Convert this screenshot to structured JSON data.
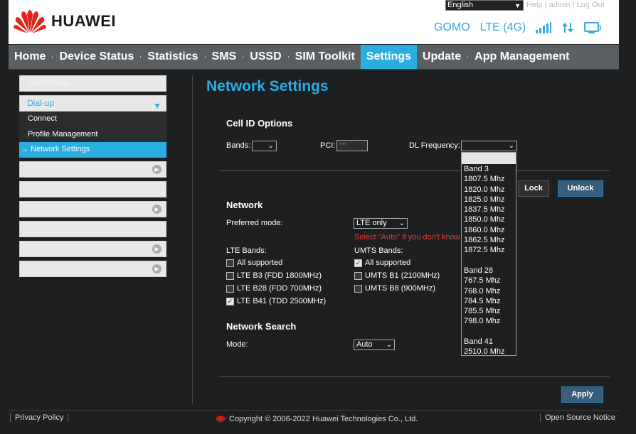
{
  "header": {
    "brand": "HUAWEI",
    "language": "English",
    "top_links": "Help | admin | Log Out",
    "operator": "GOMO",
    "network_type": "LTE (4G)"
  },
  "nav": {
    "items": [
      "Home",
      "Device Status",
      "Statistics",
      "SMS",
      "USSD",
      "SIM Toolkit",
      "Settings",
      "Update",
      "App Management"
    ],
    "active": "Settings"
  },
  "sidebar": {
    "top_item": "Quick Setup",
    "open_item": "Dial-up",
    "sub_items": [
      "Connect",
      "Profile Management",
      "Network Settings"
    ],
    "active_sub": "→ Network Settings",
    "other_items": [
      "Ethernet",
      "WLAN",
      "Security",
      "System",
      "Advanced",
      "Update"
    ]
  },
  "main": {
    "title": "Network Settings",
    "cell_id": {
      "heading": "Cell ID Options",
      "bands_label": "Bands:",
      "pci_label": "PCI:",
      "pci_placeholder": "***",
      "dl_freq_label": "DL Frequency:",
      "lock_label": "Lock",
      "unlock_label": "Unlock"
    },
    "network": {
      "heading": "Network",
      "preferred_mode_label": "Preferred mode:",
      "preferred_mode_value": "LTE only",
      "warning": "Select \"Auto\" if you don't know",
      "lte_bands_label": "LTE Bands:",
      "umts_bands_label": "UMTS Bands:",
      "lte_bands": [
        {
          "label": "All supported",
          "checked": false
        },
        {
          "label": "LTE B3 (FDD 1800MHz)",
          "checked": false
        },
        {
          "label": "LTE B28 (FDD 700MHz)",
          "checked": false
        },
        {
          "label": "LTE B41 (TDD 2500MHz)",
          "checked": true
        }
      ],
      "umts_bands": [
        {
          "label": "All supported",
          "checked": true
        },
        {
          "label": "UMTS B1 (2100MHz)",
          "checked": false
        },
        {
          "label": "UMTS B8 (900MHz)",
          "checked": false
        }
      ]
    },
    "search": {
      "heading": "Network Search",
      "mode_label": "Mode:",
      "mode_value": "Auto"
    },
    "apply_label": "Apply"
  },
  "freq_list": [
    "Band 3",
    "1807.5 Mhz",
    "1820.0 Mhz",
    "1825.0 Mhz",
    "1837.5 Mhz",
    "1850.0 Mhz",
    "1860.0 Mhz",
    "1862.5 Mhz",
    "1872.5 Mhz",
    "",
    "Band 28",
    "767.5 Mhz",
    "768.0 Mhz",
    "784.5 Mhz",
    "785.5 Mhz",
    "798.0 Mhz",
    "",
    "Band 41",
    "2510.0 Mhz"
  ],
  "footer": {
    "privacy": "Privacy Policy",
    "copyright": "Copyright © 2006-2022 Huawei Technologies Co., Ltd.",
    "open_source": "Open Source Notice"
  },
  "colors": {
    "accent": "#2aaee2",
    "warning": "#e03a3a",
    "nav_bg": "#5b5f61"
  }
}
